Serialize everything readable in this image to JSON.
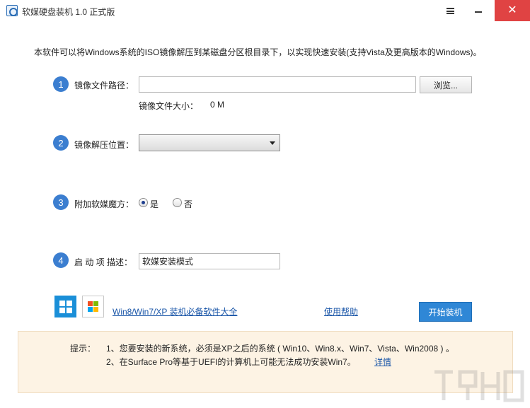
{
  "window": {
    "title": "软媒硬盘装机 1.0 正式版"
  },
  "intro": "本软件可以将Windows系统的ISO镜像解压到某磁盘分区根目录下，以实现快速安装(支持Vista及更高版本的Windows)。",
  "steps": [
    {
      "num": "1",
      "label": "镜像文件路径："
    },
    {
      "num": "2",
      "label": "镜像解压位置："
    },
    {
      "num": "3",
      "label": "附加软媒魔方："
    },
    {
      "num": "4",
      "label": "启 动 项 描述："
    }
  ],
  "image_path": {
    "value": "",
    "browse_label": "浏览...",
    "size_label": "镜像文件大小：",
    "size_value": "0 M"
  },
  "extract_location": {
    "selected": ""
  },
  "addon": {
    "yes_label": "是",
    "no_label": "否",
    "selected": "yes"
  },
  "boot_desc": {
    "value": "软媒安装模式"
  },
  "footer": {
    "software_link": "Win8/Win7/XP 装机必备软件大全",
    "help_link": "使用帮助",
    "start_label": "开始装机"
  },
  "tips": {
    "label": "提示：",
    "line1": "1、您要安装的新系统，必须是XP之后的系统 ( Win10、Win8.x、Win7、Vista、Win2008 ) 。",
    "line2": "2、在Surface Pro等基于UEFI的计算机上可能无法成功安装Win7。",
    "details_link": "详情"
  },
  "colors": {
    "accent": "#3b7ed0",
    "close_button": "#e04343",
    "start_button": "#2f87d6",
    "tip_background": "#fdf3e4",
    "link": "#1a56a8"
  },
  "icons": [
    "app-icon",
    "menu-icon",
    "minimize-icon",
    "close-icon",
    "dropdown-arrow-icon",
    "windows8-logo-icon",
    "windows7-logo-icon"
  ]
}
